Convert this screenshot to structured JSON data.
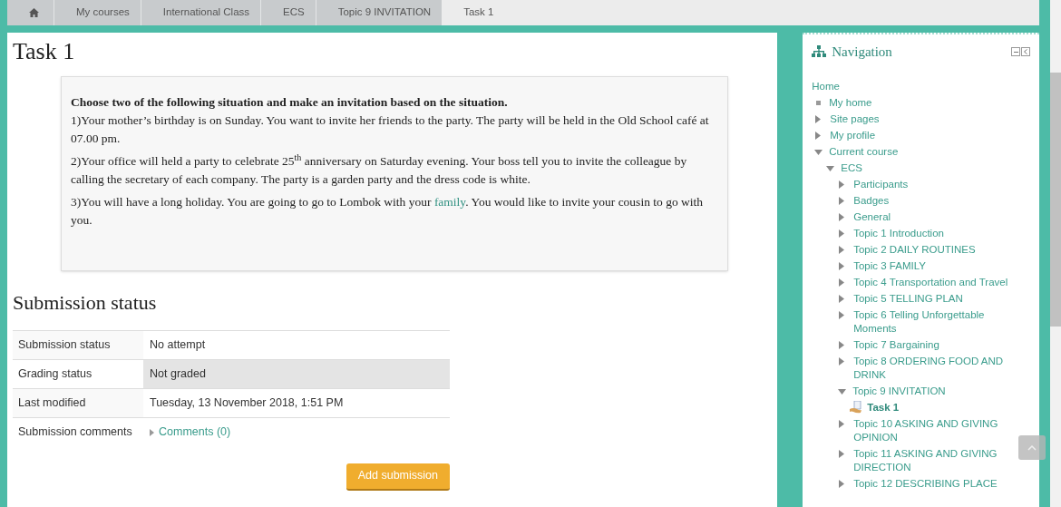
{
  "breadcrumb": [
    {
      "kind": "home"
    },
    {
      "kind": "link",
      "label": "My courses"
    },
    {
      "kind": "link",
      "label": "International Class"
    },
    {
      "kind": "link",
      "label": "ECS"
    },
    {
      "kind": "link",
      "label": "Topic 9 INVITATION"
    },
    {
      "kind": "current",
      "label": "Task 1"
    }
  ],
  "page_title": "Task 1",
  "instructions": {
    "heading": "Choose two of the following situation and make an invitation based on the situation.",
    "paragraphs": [
      {
        "text": "1)Your mother’s birthday is on Sunday. You want to invite her friends to the party. The party will be held in the Old School café at 07.00 pm."
      },
      {
        "text": "2)Your office will held a party to celebrate 25$^{th}$ anniversary on Saturday evening. Your boss tell you to invite the colleague by calling the secretary of each company. The party is a garden party and the dress code is white."
      },
      {
        "text": "3)You will have a long holiday. You are going to go to Lombok with your",
        "link": "family",
        "after": ". You would like to invite your cousin to go with you."
      }
    ]
  },
  "submission": {
    "heading": "Submission status",
    "rows": [
      {
        "label": "Submission status",
        "value": "No attempt",
        "highlighted": false
      },
      {
        "label": "Grading status",
        "value": "Not graded",
        "highlighted": true
      },
      {
        "label": "Last modified",
        "value": "Tuesday, 13 November 2018, 1:51 PM",
        "highlighted": false
      },
      {
        "label": "Submission comments",
        "link": "Comments (0)",
        "highlighted": false
      }
    ],
    "button": "Add submission"
  },
  "navigation": {
    "title": "Navigation",
    "items": [
      {
        "label": "Home",
        "kind": "root",
        "children": [
          {
            "label": "My home",
            "kind": "leaf"
          },
          {
            "label": "Site pages",
            "kind": "branch",
            "expanded": false
          },
          {
            "label": "My profile",
            "kind": "branch",
            "expanded": false
          },
          {
            "label": "Current course",
            "kind": "branch",
            "expanded": true,
            "children": [
              {
                "label": "ECS",
                "kind": "branch",
                "expanded": true,
                "children": [
                  {
                    "label": "Participants",
                    "kind": "branch",
                    "expanded": false
                  },
                  {
                    "label": "Badges",
                    "kind": "branch",
                    "expanded": false
                  },
                  {
                    "label": "General",
                    "kind": "branch",
                    "expanded": false
                  },
                  {
                    "label": "Topic 1 Introduction",
                    "kind": "branch",
                    "expanded": false
                  },
                  {
                    "label": "Topic 2 DAILY ROUTINES",
                    "kind": "branch",
                    "expanded": false
                  },
                  {
                    "label": "Topic 3 FAMILY",
                    "kind": "branch",
                    "expanded": false
                  },
                  {
                    "label": "Topic 4 Transportation and Travel",
                    "kind": "branch",
                    "expanded": false
                  },
                  {
                    "label": "Topic 5 TELLING PLAN",
                    "kind": "branch",
                    "expanded": false
                  },
                  {
                    "label": "Topic 6 Telling Unforgettable Moments",
                    "kind": "branch",
                    "expanded": false
                  },
                  {
                    "label": "Topic 7 Bargaining",
                    "kind": "branch",
                    "expanded": false
                  },
                  {
                    "label": "Topic 8 ORDERING FOOD AND DRINK",
                    "kind": "branch",
                    "expanded": false
                  },
                  {
                    "label": "Topic 9 INVITATION",
                    "kind": "branch",
                    "expanded": true,
                    "children": [
                      {
                        "label": "Task 1",
                        "kind": "activity"
                      }
                    ]
                  },
                  {
                    "label": "Topic 10 ASKING AND GIVING OPINION",
                    "kind": "branch",
                    "expanded": false
                  },
                  {
                    "label": "Topic 11 ASKING AND GIVING DIRECTION",
                    "kind": "branch",
                    "expanded": false
                  },
                  {
                    "label": "Topic 12 DESCRIBING PLACE",
                    "kind": "branch",
                    "expanded": false
                  }
                ]
              }
            ]
          }
        ]
      }
    ]
  }
}
